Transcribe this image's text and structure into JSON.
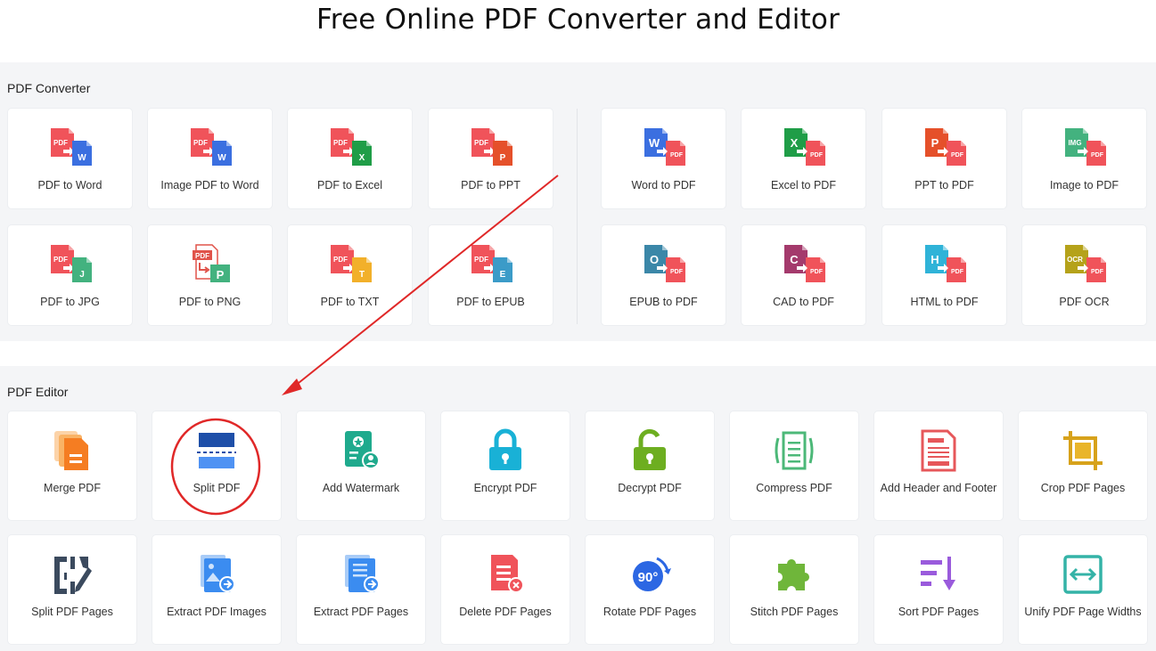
{
  "page": {
    "title": "Free Online PDF Converter and Editor"
  },
  "converter": {
    "title": "PDF Converter",
    "left": [
      {
        "label": "PDF to Word",
        "badge": "W",
        "badge_color": "#3b6fe0",
        "src": "PDF",
        "icon": "pdf-to-word-icon"
      },
      {
        "label": "Image PDF to Word",
        "badge": "W",
        "badge_color": "#3b6fe0",
        "src": "PDF",
        "icon": "image-pdf-to-word-icon"
      },
      {
        "label": "PDF to Excel",
        "badge": "X",
        "badge_color": "#1f9d47",
        "src": "PDF",
        "icon": "pdf-to-excel-icon"
      },
      {
        "label": "PDF to PPT",
        "badge": "P",
        "badge_color": "#e5502a",
        "src": "PDF",
        "icon": "pdf-to-ppt-icon"
      },
      {
        "label": "PDF to JPG",
        "badge": "J",
        "badge_color": "#43b27f",
        "src": "PDF",
        "icon": "pdf-to-jpg-icon"
      },
      {
        "label": "PDF to PNG",
        "badge": "P",
        "badge_color": "#43b27f",
        "src": "PDF",
        "icon": "pdf-to-png-icon"
      },
      {
        "label": "PDF to TXT",
        "badge": "T",
        "badge_color": "#f2b02a",
        "src": "PDF",
        "icon": "pdf-to-txt-icon"
      },
      {
        "label": "PDF to EPUB",
        "badge": "E",
        "badge_color": "#3b9bc8",
        "src": "PDF",
        "icon": "pdf-to-epub-icon"
      }
    ],
    "right": [
      {
        "label": "Word to PDF",
        "src": "W",
        "src_color": "#3b6fe0",
        "badge": "PDF",
        "icon": "word-to-pdf-icon"
      },
      {
        "label": "Excel to PDF",
        "src": "X",
        "src_color": "#1f9d47",
        "badge": "PDF",
        "icon": "excel-to-pdf-icon"
      },
      {
        "label": "PPT to PDF",
        "src": "P",
        "src_color": "#e5502a",
        "badge": "PDF",
        "icon": "ppt-to-pdf-icon"
      },
      {
        "label": "Image to PDF",
        "src": "IMG",
        "src_color": "#43b27f",
        "badge": "PDF",
        "icon": "image-to-pdf-icon"
      },
      {
        "label": "EPUB to PDF",
        "src": "O",
        "src_color": "#3b87a8",
        "badge": "PDF",
        "icon": "epub-to-pdf-icon"
      },
      {
        "label": "CAD to PDF",
        "src": "C",
        "src_color": "#a43a6c",
        "badge": "PDF",
        "icon": "cad-to-pdf-icon"
      },
      {
        "label": "HTML to PDF",
        "src": "H",
        "src_color": "#2fb3d8",
        "badge": "PDF",
        "icon": "html-to-pdf-icon"
      },
      {
        "label": "PDF OCR",
        "src": "OCR",
        "src_color": "#b5a21a",
        "badge": "PDF",
        "icon": "pdf-ocr-icon"
      }
    ]
  },
  "editor": {
    "title": "PDF Editor",
    "tools": [
      {
        "label": "Merge PDF",
        "icon": "merge-pdf-icon"
      },
      {
        "label": "Split PDF",
        "icon": "split-pdf-icon"
      },
      {
        "label": "Add Watermark",
        "icon": "add-watermark-icon"
      },
      {
        "label": "Encrypt PDF",
        "icon": "lock-icon"
      },
      {
        "label": "Decrypt PDF",
        "icon": "unlock-icon"
      },
      {
        "label": "Compress PDF",
        "icon": "compress-pdf-icon"
      },
      {
        "label": "Add Header and Footer",
        "icon": "header-footer-icon"
      },
      {
        "label": "Crop PDF Pages",
        "icon": "crop-icon"
      },
      {
        "label": "Split PDF Pages",
        "icon": "split-pages-icon"
      },
      {
        "label": "Extract PDF Images",
        "icon": "extract-images-icon"
      },
      {
        "label": "Extract PDF Pages",
        "icon": "extract-pages-icon"
      },
      {
        "label": "Delete PDF Pages",
        "icon": "delete-pages-icon"
      },
      {
        "label": "Rotate PDF Pages",
        "icon": "rotate-icon",
        "badge": "90°"
      },
      {
        "label": "Stitch PDF Pages",
        "icon": "puzzle-icon"
      },
      {
        "label": "Sort PDF Pages",
        "icon": "sort-icon"
      },
      {
        "label": "Unify PDF Page Widths",
        "icon": "unify-width-icon"
      }
    ]
  },
  "colors": {
    "pdf_red": "#f0535a",
    "annotation_red": "#e02828",
    "section_bg": "#f4f5f7"
  }
}
